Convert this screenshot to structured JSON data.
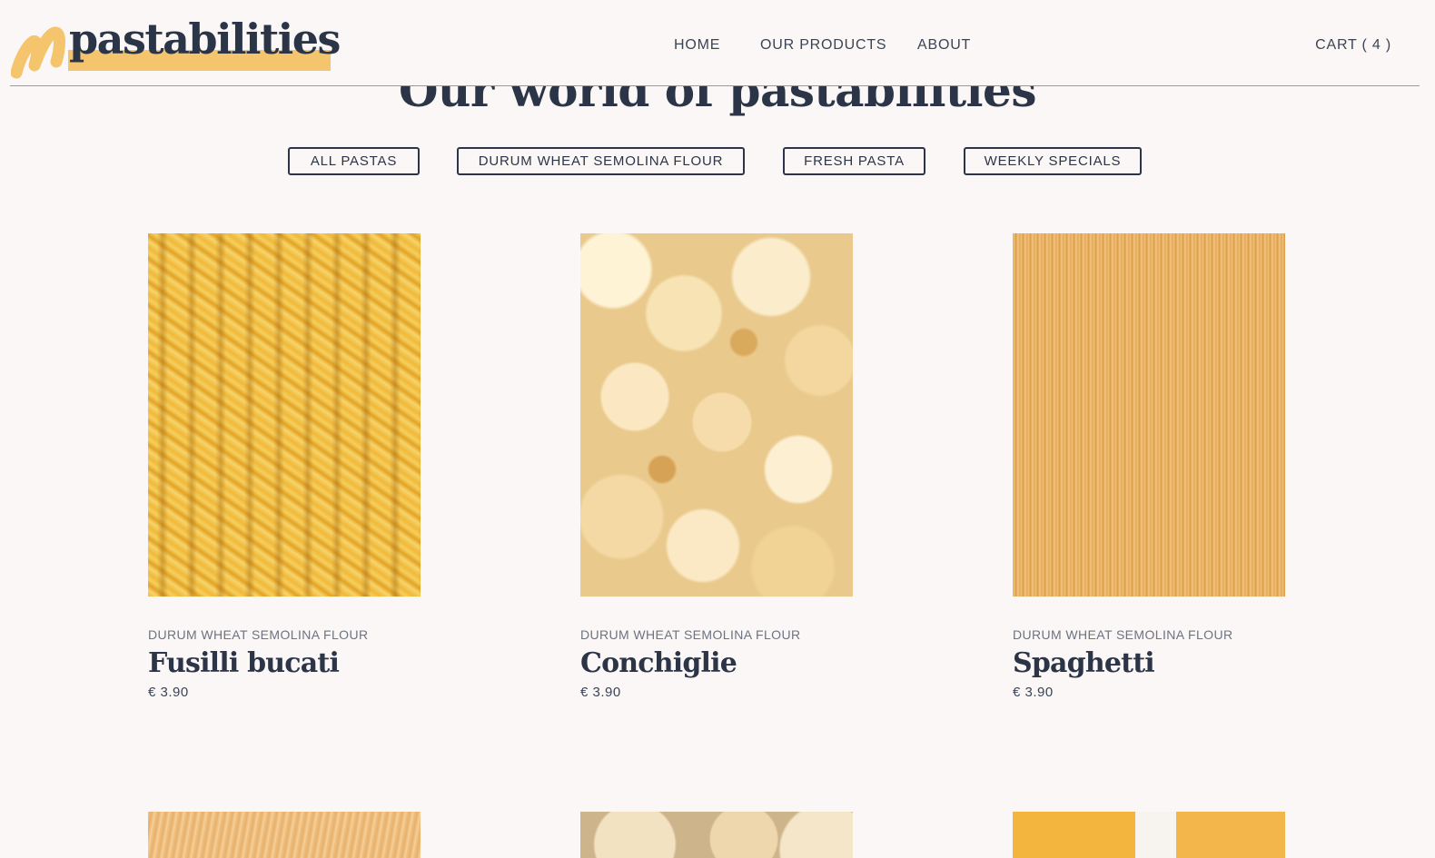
{
  "header": {
    "logo_text": "pastabilities",
    "nav": {
      "home": "HOME",
      "products": "OUR PRODUCTS",
      "about": "ABOUT"
    },
    "cart": "CART ( 4 )"
  },
  "section_title": "Our world of pastabilities",
  "filters": [
    {
      "label": "ALL PASTAS"
    },
    {
      "label": "DURUM WHEAT SEMOLINA FLOUR"
    },
    {
      "label": "FRESH PASTA"
    },
    {
      "label": "WEEKLY SPECIALS"
    }
  ],
  "products": [
    {
      "category": "DURUM WHEAT SEMOLINA FLOUR",
      "name": "Fusilli bucati",
      "price": "€ 3.90",
      "image": "fusilli-pasta"
    },
    {
      "category": "DURUM WHEAT SEMOLINA FLOUR",
      "name": "Conchiglie",
      "price": "€ 3.90",
      "image": "conchiglie-pasta"
    },
    {
      "category": "DURUM WHEAT SEMOLINA FLOUR",
      "name": "Spaghetti",
      "price": "€ 3.90",
      "image": "spaghetti-pasta"
    }
  ],
  "colors": {
    "background": "#faf7f6",
    "text_navy": "#2b3547",
    "accent_yellow": "#f4c56d"
  }
}
